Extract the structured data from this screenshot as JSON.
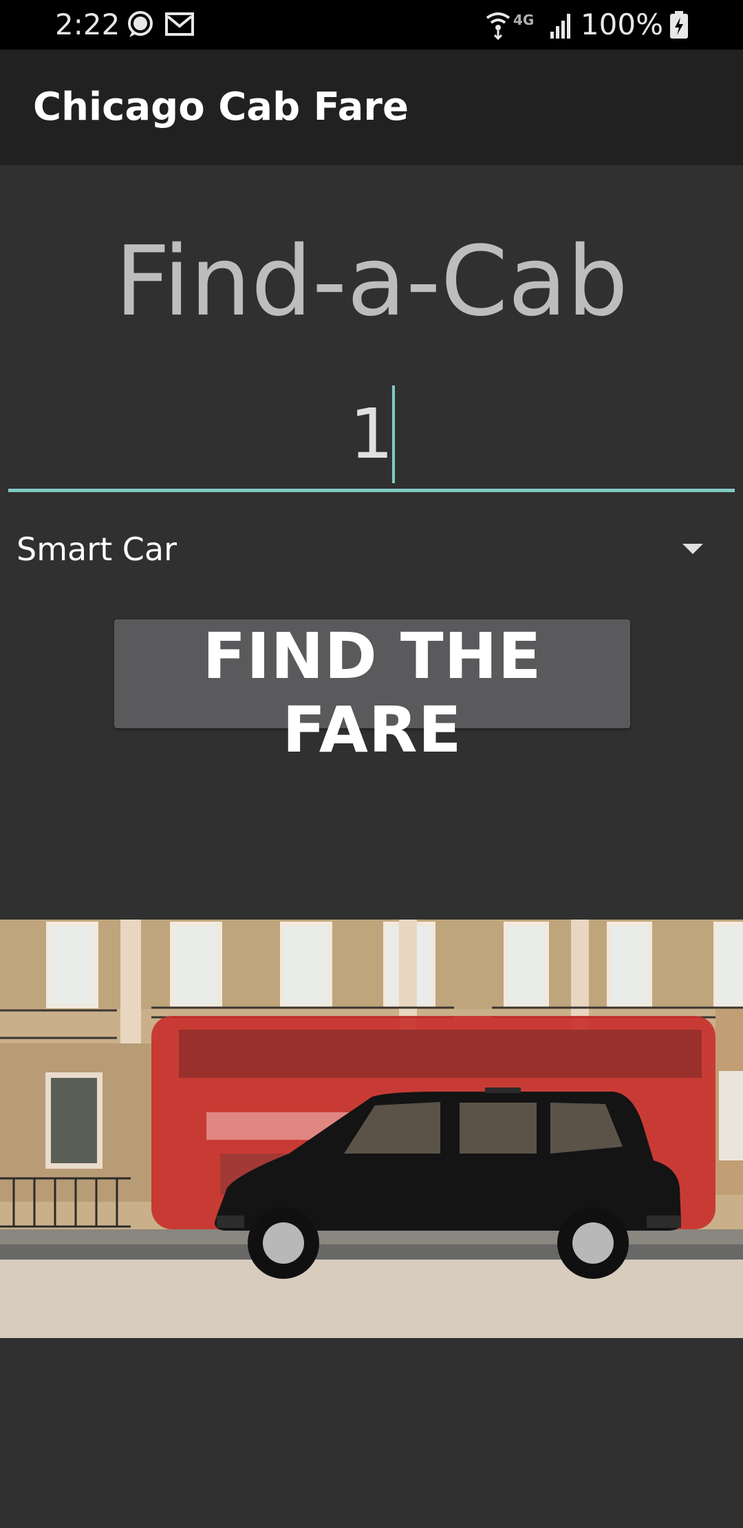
{
  "status_bar": {
    "time": "2:22",
    "battery_percent": "100%",
    "network_label": "4G",
    "icons": [
      "chat-bubble-icon",
      "gmail-icon",
      "wifi-icon",
      "lte-icon",
      "signal-icon",
      "battery-charging-icon"
    ]
  },
  "app_bar": {
    "title": "Chicago Cab Fare"
  },
  "main": {
    "heading": "Find-a-Cab",
    "input_value": "1",
    "spinner_selected": "Smart Car",
    "button_label": "FIND THE FARE",
    "photo_icon": "taxi-photo"
  },
  "colors": {
    "accent": "#80cbc4",
    "background": "#303030",
    "app_bar": "#212121",
    "button": "#5a5a5c",
    "heading_text": "#bdbdbd"
  }
}
